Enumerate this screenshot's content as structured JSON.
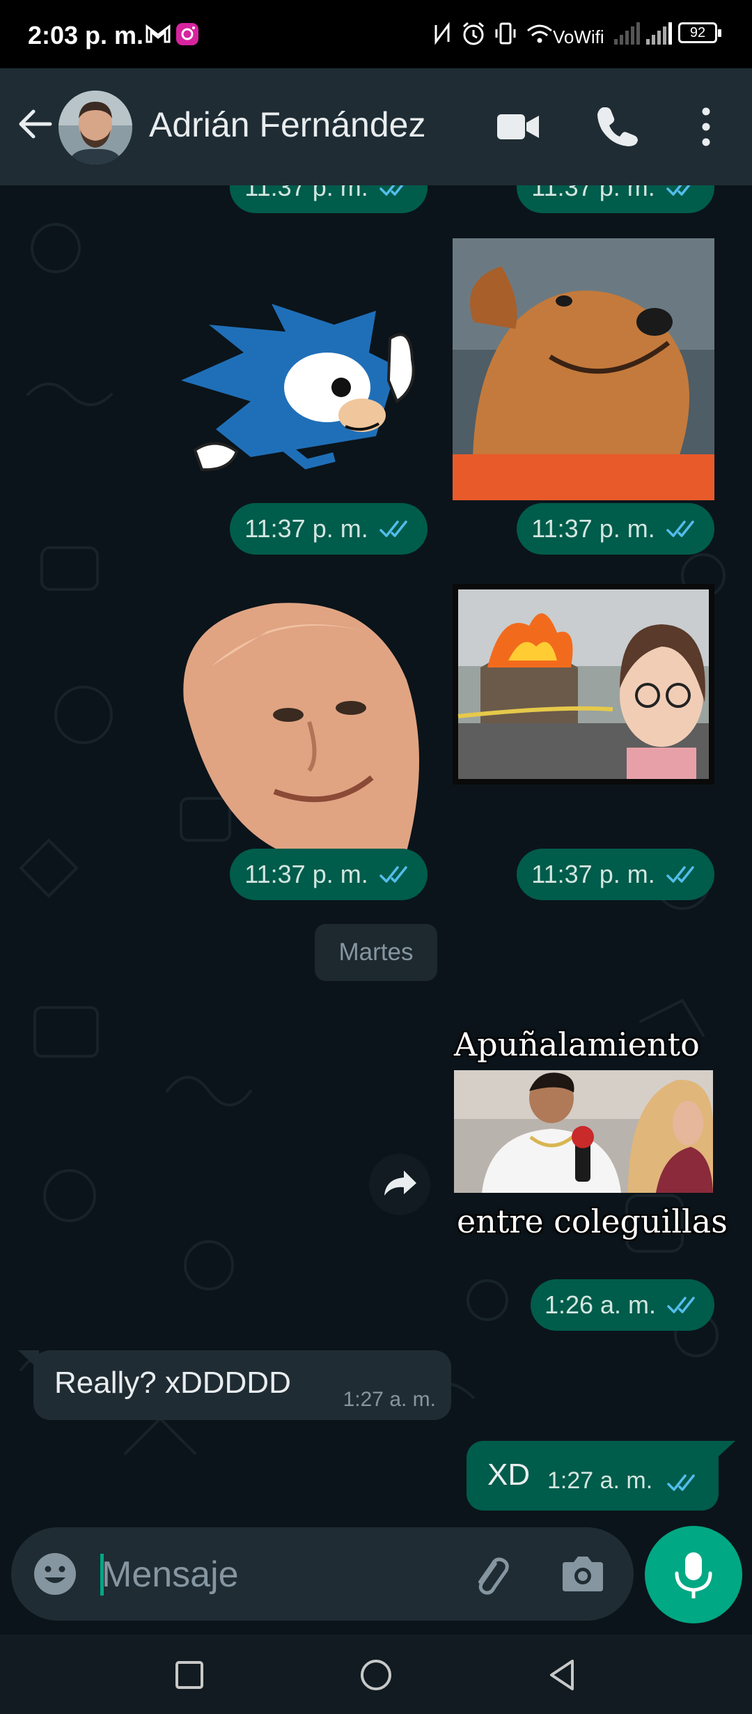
{
  "status_bar": {
    "time": "2:03 p. m.",
    "network_label": "VoWifi",
    "battery": "92"
  },
  "header": {
    "contact_name": "Adrián Fernández"
  },
  "chat": {
    "top_partial_times": [
      "11:37 p. m.",
      "11:37 p. m."
    ],
    "sticker_rows": [
      {
        "left_time": "11:37 p. m.",
        "right_time": "11:37 p. m."
      },
      {
        "left_time": "11:37 p. m.",
        "right_time": "11:37 p. m."
      }
    ],
    "date_chip": "Martes",
    "meme_sticker": {
      "caption_top": "Apuñalamiento",
      "caption_bottom": "entre coleguillas",
      "time": "1:26 a. m."
    },
    "incoming": {
      "text": "Really? xDDDDD",
      "time": "1:27 a. m."
    },
    "outgoing": {
      "text": "XD",
      "time": "1:27 a. m."
    }
  },
  "composer": {
    "placeholder": "Mensaje"
  },
  "colors": {
    "header": "#1f2c34",
    "chat_bg": "#0b141a",
    "outgoing": "#005c4b",
    "incoming": "#202c33",
    "accent": "#00a884",
    "read_ticks": "#53bdeb"
  }
}
